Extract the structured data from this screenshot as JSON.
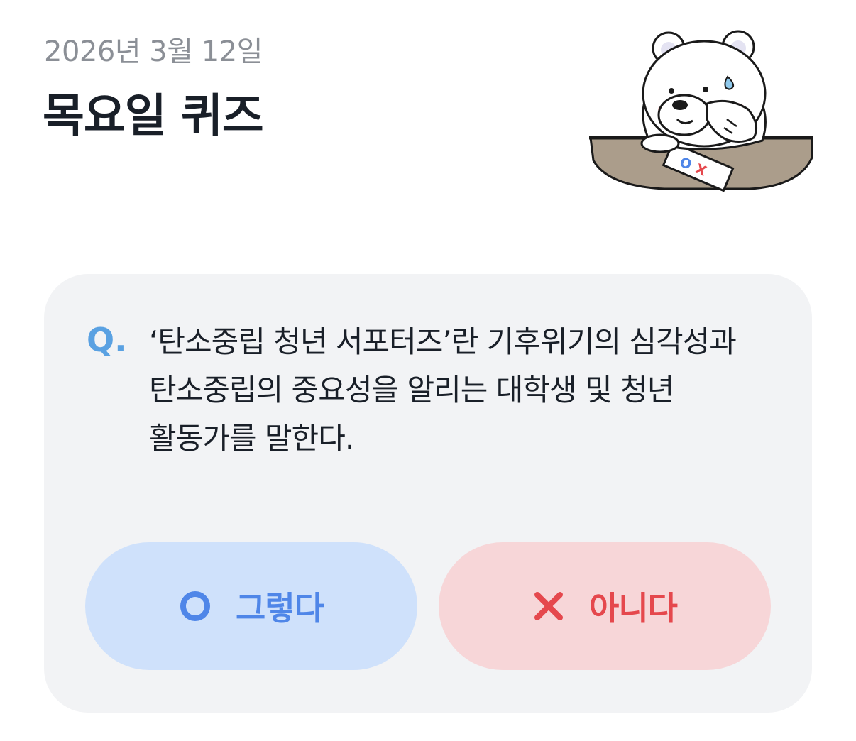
{
  "header": {
    "date": "2026년 3월 12일",
    "title": "목요일 퀴즈"
  },
  "mascot": {
    "icon": "polar-bear-mascot-icon",
    "paper_text_o": "O",
    "paper_text_x": "X"
  },
  "quiz": {
    "q_label": "Q.",
    "question": "‘탄소중립 청년 서포터즈’란 기후위기의 심각성과 탄소중립의 중요성을 알리는 대학생 및 청년 활동가를 말한다."
  },
  "answers": {
    "yes": {
      "label": "그렇다",
      "icon": "circle-o-icon",
      "color": "#4f86e8",
      "background": "#cfe1fb"
    },
    "no": {
      "label": "아니다",
      "icon": "x-icon",
      "color": "#e5484d",
      "background": "#f7d6d8"
    }
  },
  "colors": {
    "card_background": "#f2f3f5",
    "q_accent": "#5aa1e2"
  }
}
